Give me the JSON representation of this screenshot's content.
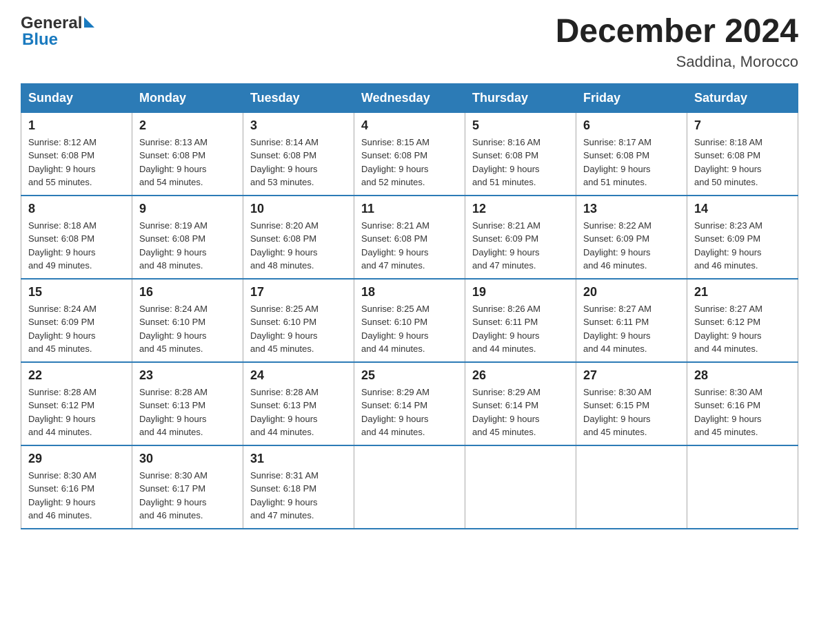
{
  "logo": {
    "general": "General",
    "blue": "Blue"
  },
  "title": "December 2024",
  "subtitle": "Saddina, Morocco",
  "days_of_week": [
    "Sunday",
    "Monday",
    "Tuesday",
    "Wednesday",
    "Thursday",
    "Friday",
    "Saturday"
  ],
  "weeks": [
    [
      {
        "day": "1",
        "sunrise": "8:12 AM",
        "sunset": "6:08 PM",
        "daylight": "9 hours and 55 minutes."
      },
      {
        "day": "2",
        "sunrise": "8:13 AM",
        "sunset": "6:08 PM",
        "daylight": "9 hours and 54 minutes."
      },
      {
        "day": "3",
        "sunrise": "8:14 AM",
        "sunset": "6:08 PM",
        "daylight": "9 hours and 53 minutes."
      },
      {
        "day": "4",
        "sunrise": "8:15 AM",
        "sunset": "6:08 PM",
        "daylight": "9 hours and 52 minutes."
      },
      {
        "day": "5",
        "sunrise": "8:16 AM",
        "sunset": "6:08 PM",
        "daylight": "9 hours and 51 minutes."
      },
      {
        "day": "6",
        "sunrise": "8:17 AM",
        "sunset": "6:08 PM",
        "daylight": "9 hours and 51 minutes."
      },
      {
        "day": "7",
        "sunrise": "8:18 AM",
        "sunset": "6:08 PM",
        "daylight": "9 hours and 50 minutes."
      }
    ],
    [
      {
        "day": "8",
        "sunrise": "8:18 AM",
        "sunset": "6:08 PM",
        "daylight": "9 hours and 49 minutes."
      },
      {
        "day": "9",
        "sunrise": "8:19 AM",
        "sunset": "6:08 PM",
        "daylight": "9 hours and 48 minutes."
      },
      {
        "day": "10",
        "sunrise": "8:20 AM",
        "sunset": "6:08 PM",
        "daylight": "9 hours and 48 minutes."
      },
      {
        "day": "11",
        "sunrise": "8:21 AM",
        "sunset": "6:08 PM",
        "daylight": "9 hours and 47 minutes."
      },
      {
        "day": "12",
        "sunrise": "8:21 AM",
        "sunset": "6:09 PM",
        "daylight": "9 hours and 47 minutes."
      },
      {
        "day": "13",
        "sunrise": "8:22 AM",
        "sunset": "6:09 PM",
        "daylight": "9 hours and 46 minutes."
      },
      {
        "day": "14",
        "sunrise": "8:23 AM",
        "sunset": "6:09 PM",
        "daylight": "9 hours and 46 minutes."
      }
    ],
    [
      {
        "day": "15",
        "sunrise": "8:24 AM",
        "sunset": "6:09 PM",
        "daylight": "9 hours and 45 minutes."
      },
      {
        "day": "16",
        "sunrise": "8:24 AM",
        "sunset": "6:10 PM",
        "daylight": "9 hours and 45 minutes."
      },
      {
        "day": "17",
        "sunrise": "8:25 AM",
        "sunset": "6:10 PM",
        "daylight": "9 hours and 45 minutes."
      },
      {
        "day": "18",
        "sunrise": "8:25 AM",
        "sunset": "6:10 PM",
        "daylight": "9 hours and 44 minutes."
      },
      {
        "day": "19",
        "sunrise": "8:26 AM",
        "sunset": "6:11 PM",
        "daylight": "9 hours and 44 minutes."
      },
      {
        "day": "20",
        "sunrise": "8:27 AM",
        "sunset": "6:11 PM",
        "daylight": "9 hours and 44 minutes."
      },
      {
        "day": "21",
        "sunrise": "8:27 AM",
        "sunset": "6:12 PM",
        "daylight": "9 hours and 44 minutes."
      }
    ],
    [
      {
        "day": "22",
        "sunrise": "8:28 AM",
        "sunset": "6:12 PM",
        "daylight": "9 hours and 44 minutes."
      },
      {
        "day": "23",
        "sunrise": "8:28 AM",
        "sunset": "6:13 PM",
        "daylight": "9 hours and 44 minutes."
      },
      {
        "day": "24",
        "sunrise": "8:28 AM",
        "sunset": "6:13 PM",
        "daylight": "9 hours and 44 minutes."
      },
      {
        "day": "25",
        "sunrise": "8:29 AM",
        "sunset": "6:14 PM",
        "daylight": "9 hours and 44 minutes."
      },
      {
        "day": "26",
        "sunrise": "8:29 AM",
        "sunset": "6:14 PM",
        "daylight": "9 hours and 45 minutes."
      },
      {
        "day": "27",
        "sunrise": "8:30 AM",
        "sunset": "6:15 PM",
        "daylight": "9 hours and 45 minutes."
      },
      {
        "day": "28",
        "sunrise": "8:30 AM",
        "sunset": "6:16 PM",
        "daylight": "9 hours and 45 minutes."
      }
    ],
    [
      {
        "day": "29",
        "sunrise": "8:30 AM",
        "sunset": "6:16 PM",
        "daylight": "9 hours and 46 minutes."
      },
      {
        "day": "30",
        "sunrise": "8:30 AM",
        "sunset": "6:17 PM",
        "daylight": "9 hours and 46 minutes."
      },
      {
        "day": "31",
        "sunrise": "8:31 AM",
        "sunset": "6:18 PM",
        "daylight": "9 hours and 47 minutes."
      },
      null,
      null,
      null,
      null
    ]
  ],
  "labels": {
    "sunrise": "Sunrise:",
    "sunset": "Sunset:",
    "daylight": "Daylight:"
  }
}
